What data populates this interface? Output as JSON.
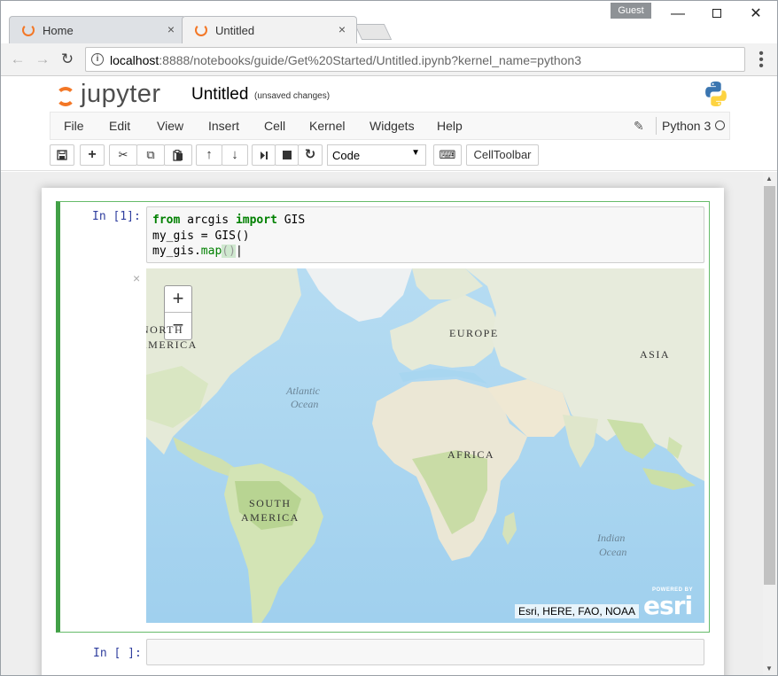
{
  "browser": {
    "tabs": [
      {
        "title": "Home",
        "close": "×"
      },
      {
        "title": "Untitled",
        "close": "×"
      }
    ],
    "guest_label": "Guest",
    "window_controls": {
      "minimize": "—",
      "close": "✕"
    },
    "url_host": "localhost",
    "url_rest": ":8888/notebooks/guide/Get%20Started/Untitled.ipynb?kernel_name=python3",
    "info_icon": "i",
    "nav": {
      "back": "←",
      "forward": "→",
      "reload": "↻"
    },
    "menu_icon": "⋮"
  },
  "jupyter": {
    "logo_text": "jupyter",
    "notebook_name": "Untitled",
    "autosave_status": "(unsaved changes)",
    "menu": [
      "File",
      "Edit",
      "View",
      "Insert",
      "Cell",
      "Kernel",
      "Widgets",
      "Help"
    ],
    "kernel_name": "Python 3",
    "toolbar": {
      "save": "💾",
      "add": "+",
      "cut": "✂",
      "copy": "⧉",
      "paste": "📋",
      "move_up": "↑",
      "move_down": "↓",
      "run": "⏭",
      "stop": "■",
      "restart": "↻",
      "cell_type": "Code",
      "keyboard": "⌨",
      "cell_toolbar": "CellToolbar"
    }
  },
  "notebook": {
    "cell1": {
      "prompt": "In [1]:",
      "code_line1_kw1": "from",
      "code_line1_mid": " arcgis ",
      "code_line1_kw2": "import",
      "code_line1_end": " GIS",
      "code_line2": "my_gis = GIS()",
      "code_line3_start": "my_gis.",
      "code_line3_fn": "map",
      "code_line3_paren": "()",
      "output_close": "×"
    },
    "map": {
      "zoom_in": "+",
      "zoom_out": "−",
      "labels": {
        "north_america_1": "NORTH",
        "north_america_2": "AMERICA",
        "europe": "EUROPE",
        "asia": "ASIA",
        "africa": "AFRICA",
        "south_america_1": "SOUTH",
        "south_america_2": "AMERICA",
        "atlantic_1": "Atlantic",
        "atlantic_2": "Ocean",
        "indian_1": "Indian",
        "indian_2": "Ocean"
      },
      "attribution": "Esri, HERE, FAO, NOAA",
      "esri_powered": "POWERED BY",
      "esri_brand": "esri"
    },
    "cell2": {
      "prompt": "In [ ]:"
    }
  },
  "colors": {
    "jupyter_orange": "#f37726",
    "cell_green": "#42a047",
    "prompt_blue": "#303f9f",
    "ocean": "#a8d6f0",
    "land": "#eaeee0"
  }
}
